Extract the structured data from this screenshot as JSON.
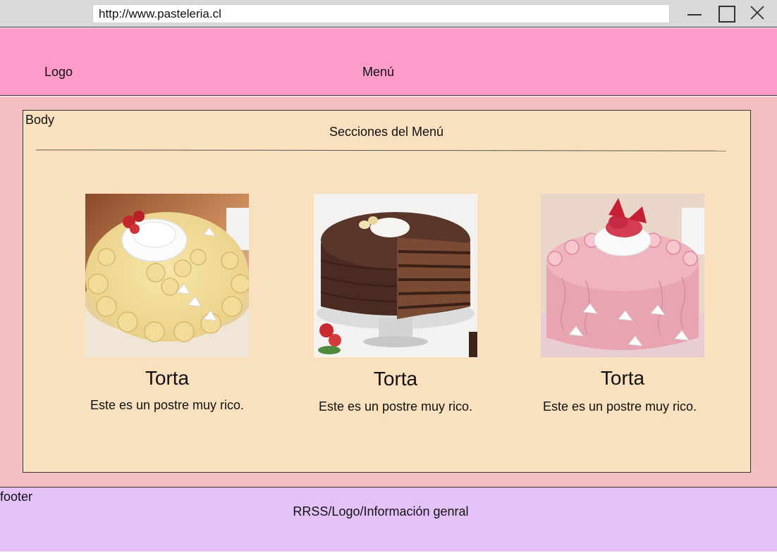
{
  "browser": {
    "url": "http://www.pasteleria.cl",
    "minimize_icon": "minimize-icon",
    "maximize_icon": "maximize-icon",
    "close_icon": "close-icon"
  },
  "header": {
    "logo_label": "Logo",
    "menu_label": "Menú",
    "background": "#ff9bc8"
  },
  "body": {
    "label": "Body",
    "section_title": "Secciones del Menú",
    "background": "#f9e1bf",
    "outer_background": "#f3bfc1",
    "cards": [
      {
        "image": "vanilla-cream-cake-image",
        "title": "Torta",
        "description": "Este es un postre muy rico."
      },
      {
        "image": "chocolate-layer-cake-image",
        "title": "Torta",
        "description": "Este es un postre muy rico."
      },
      {
        "image": "strawberry-cream-cake-image",
        "title": "Torta",
        "description": "Este es un postre muy rico."
      }
    ]
  },
  "footer": {
    "label": "footer",
    "text": "RRSS/Logo/Información genral",
    "background": "#e4c1f9"
  }
}
